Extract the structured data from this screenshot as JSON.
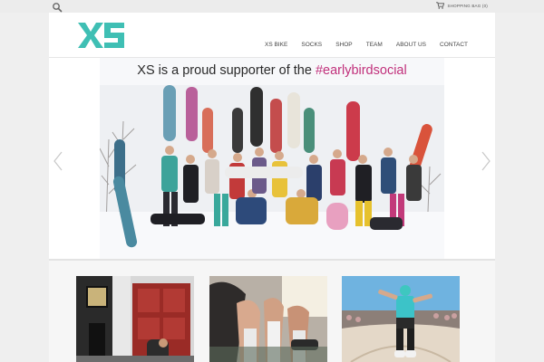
{
  "topbar": {
    "search_icon": "search-icon",
    "cart_icon": "cart-icon",
    "cart_label": "SHOPPING BAG (0)"
  },
  "header": {
    "logo_text": "XS",
    "brand_color": "#3fbfb4",
    "nav": [
      {
        "label": "XS BIKE"
      },
      {
        "label": "SOCKS"
      },
      {
        "label": "SHOP"
      },
      {
        "label": "TEAM"
      },
      {
        "label": "ABOUT US"
      },
      {
        "label": "CONTACT"
      }
    ]
  },
  "slider": {
    "caption_prefix": "XS is a proud supporter of the ",
    "caption_hashtag": "#earlybirdsocial",
    "hashtag_color": "#c1307b",
    "prev_icon": "chevron-left-icon",
    "next_icon": "chevron-right-icon"
  },
  "thumbnails": [
    {
      "name": "thumb-storefront"
    },
    {
      "name": "thumb-legs-socks"
    },
    {
      "name": "thumb-skater"
    }
  ]
}
